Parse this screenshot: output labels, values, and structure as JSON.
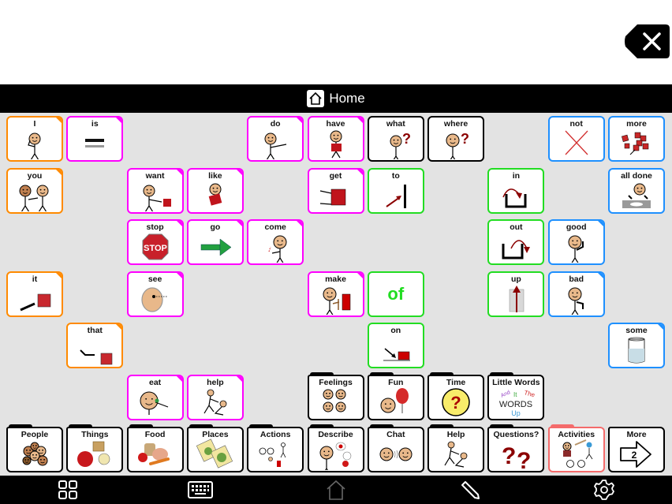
{
  "window": {
    "title": "Home"
  },
  "message_area": {
    "text": "",
    "clear_button": "clear-message"
  },
  "colors": {
    "pronoun": "#ff8a00",
    "verb": "#ff00ff",
    "question": "#000000",
    "preposition": "#22dd22",
    "adjective": "#1e90ff",
    "folder": "#000000",
    "folder_active": "#f46b6b",
    "grid_bg": "#e3e3e3"
  },
  "cells": [
    {
      "label": "I",
      "col": 0,
      "row": 0,
      "cat": "pronoun",
      "icon": "person-pointing-self-icon",
      "corner": true
    },
    {
      "label": "is",
      "col": 1,
      "row": 0,
      "cat": "verb",
      "icon": "equals-icon",
      "corner": true
    },
    {
      "label": "do",
      "col": 4,
      "row": 0,
      "cat": "verb",
      "icon": "person-reaching-icon",
      "corner": true
    },
    {
      "label": "have",
      "col": 5,
      "row": 0,
      "cat": "verb",
      "icon": "person-holding-box-icon",
      "corner": true
    },
    {
      "label": "what",
      "col": 6,
      "row": 0,
      "cat": "question",
      "icon": "person-question-icon",
      "corner": false
    },
    {
      "label": "where",
      "col": 7,
      "row": 0,
      "cat": "question",
      "icon": "person-looking-question-icon",
      "corner": false
    },
    {
      "label": "not",
      "col": 9,
      "row": 0,
      "cat": "adjective",
      "icon": "red-x-icon",
      "corner": false
    },
    {
      "label": "more",
      "col": 10,
      "row": 0,
      "cat": "adjective",
      "icon": "red-blocks-icon",
      "corner": false
    },
    {
      "label": "you",
      "col": 0,
      "row": 1,
      "cat": "pronoun",
      "icon": "two-people-pointing-icon",
      "corner": true
    },
    {
      "label": "want",
      "col": 2,
      "row": 1,
      "cat": "verb",
      "icon": "person-reaching-block-icon",
      "corner": true
    },
    {
      "label": "like",
      "col": 3,
      "row": 1,
      "cat": "verb",
      "icon": "person-hugging-block-icon",
      "corner": true
    },
    {
      "label": "get",
      "col": 5,
      "row": 1,
      "cat": "verb",
      "icon": "hands-grabbing-block-icon",
      "corner": true
    },
    {
      "label": "to",
      "col": 6,
      "row": 1,
      "cat": "preposition",
      "icon": "arrow-to-line-icon",
      "corner": false
    },
    {
      "label": "in",
      "col": 8,
      "row": 1,
      "cat": "preposition",
      "icon": "arrow-into-container-icon",
      "corner": false
    },
    {
      "label": "all done",
      "col": 10,
      "row": 1,
      "cat": "adjective",
      "icon": "person-finished-plate-icon",
      "corner": false
    },
    {
      "label": "stop",
      "col": 2,
      "row": 2,
      "cat": "verb",
      "icon": "stop-sign-icon",
      "corner": true
    },
    {
      "label": "go",
      "col": 3,
      "row": 2,
      "cat": "verb",
      "icon": "green-arrow-icon",
      "corner": true
    },
    {
      "label": "come",
      "col": 4,
      "row": 2,
      "cat": "verb",
      "icon": "person-beckoning-icon",
      "corner": true
    },
    {
      "label": "out",
      "col": 8,
      "row": 2,
      "cat": "preposition",
      "icon": "arrow-out-of-container-icon",
      "corner": false
    },
    {
      "label": "good",
      "col": 9,
      "row": 2,
      "cat": "adjective",
      "icon": "person-thumbs-up-icon",
      "corner": true
    },
    {
      "label": "it",
      "col": 0,
      "row": 3,
      "cat": "pronoun",
      "icon": "hand-pointing-block-icon",
      "corner": true
    },
    {
      "label": "see",
      "col": 2,
      "row": 3,
      "cat": "verb",
      "icon": "face-looking-icon",
      "corner": true
    },
    {
      "label": "make",
      "col": 5,
      "row": 3,
      "cat": "verb",
      "icon": "person-hammering-icon",
      "corner": true
    },
    {
      "label": "of",
      "col": 6,
      "row": 3,
      "cat": "preposition",
      "icon": "text-of",
      "corner": false,
      "big": true
    },
    {
      "label": "up",
      "col": 8,
      "row": 3,
      "cat": "preposition",
      "icon": "arrow-up-icon",
      "corner": false
    },
    {
      "label": "bad",
      "col": 9,
      "row": 3,
      "cat": "adjective",
      "icon": "person-thumbs-down-icon",
      "corner": true
    },
    {
      "label": "that",
      "col": 1,
      "row": 4,
      "cat": "pronoun",
      "icon": "hand-pointing-far-block-icon",
      "corner": true
    },
    {
      "label": "on",
      "col": 6,
      "row": 4,
      "cat": "preposition",
      "icon": "arrow-on-surface-icon",
      "corner": false
    },
    {
      "label": "some",
      "col": 10,
      "row": 4,
      "cat": "adjective",
      "icon": "glass-half-full-icon",
      "corner": true
    },
    {
      "label": "eat",
      "col": 2,
      "row": 5,
      "cat": "verb",
      "icon": "person-eating-icon",
      "corner": true
    },
    {
      "label": "help",
      "col": 3,
      "row": 5,
      "cat": "verb",
      "icon": "person-helping-icon",
      "corner": true
    },
    {
      "label": "Feelings",
      "col": 5,
      "row": 5,
      "cat": "folder",
      "icon": "feelings-faces-icon",
      "folder": true
    },
    {
      "label": "Fun",
      "col": 6,
      "row": 5,
      "cat": "folder",
      "icon": "balloon-face-icon",
      "folder": true
    },
    {
      "label": "Time",
      "col": 7,
      "row": 5,
      "cat": "folder",
      "icon": "clock-question-icon",
      "folder": true
    },
    {
      "label": "Little Words",
      "col": 8,
      "row": 5,
      "cat": "folder",
      "icon": "little-words-icon",
      "folder": true
    },
    {
      "label": "People",
      "col": 0,
      "row": 6,
      "cat": "folder",
      "icon": "group-of-people-icon",
      "folder": true
    },
    {
      "label": "Things",
      "col": 1,
      "row": 6,
      "cat": "folder",
      "icon": "ball-basket-fan-icon",
      "folder": true
    },
    {
      "label": "Food",
      "col": 2,
      "row": 6,
      "cat": "folder",
      "icon": "food-items-icon",
      "folder": true
    },
    {
      "label": "Places",
      "col": 3,
      "row": 6,
      "cat": "folder",
      "icon": "maps-icon",
      "folder": true
    },
    {
      "label": "Actions",
      "col": 4,
      "row": 6,
      "cat": "folder",
      "icon": "actions-people-icon",
      "folder": true
    },
    {
      "label": "Describe",
      "col": 5,
      "row": 6,
      "cat": "folder",
      "icon": "person-describing-icon",
      "folder": true
    },
    {
      "label": "Chat",
      "col": 6,
      "row": 6,
      "cat": "folder",
      "icon": "two-faces-talking-icon",
      "folder": true
    },
    {
      "label": "Help",
      "col": 7,
      "row": 6,
      "cat": "folder",
      "icon": "person-helping-icon",
      "folder": true
    },
    {
      "label": "Questions?",
      "col": 8,
      "row": 6,
      "cat": "folder",
      "icon": "question-marks-icon",
      "folder": true
    },
    {
      "label": "Activities",
      "col": 9,
      "row": 6,
      "cat": "folder_active",
      "icon": "sports-activities-icon",
      "folder": true
    },
    {
      "label": "More",
      "col": 10,
      "row": 6,
      "cat": "folder",
      "icon": "next-page-arrow-icon",
      "page": "2",
      "folder": false
    }
  ],
  "little_words": {
    "and": "And",
    "it": "It",
    "the": "The",
    "words": "WORDS",
    "up": "Up"
  },
  "bottom_bar": [
    {
      "name": "grid-icon"
    },
    {
      "name": "keyboard-icon"
    },
    {
      "name": "home-icon"
    },
    {
      "name": "pencil-edit-icon"
    },
    {
      "name": "settings-gear-icon"
    }
  ]
}
